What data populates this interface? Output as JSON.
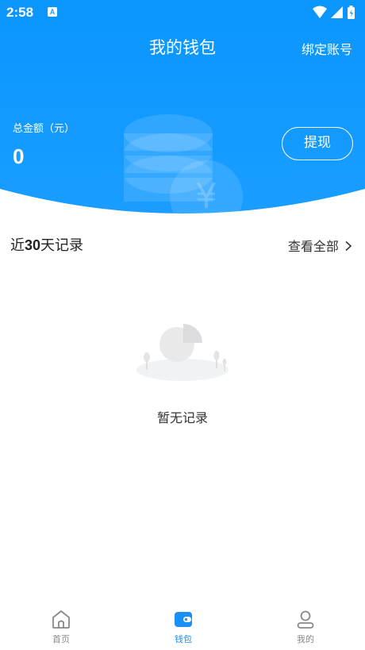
{
  "status_bar": {
    "time": "2:58",
    "notif_letter": "A"
  },
  "header": {
    "title": "我的钱包",
    "bind_account_label": "绑定账号",
    "total_label": "总金额（元）",
    "total_value": "0",
    "withdraw_label": "提现",
    "currency_symbol": "¥",
    "accent_color": "#0a96ff"
  },
  "records": {
    "title_prefix": "近",
    "title_number": "30",
    "title_suffix": "天记录",
    "view_all_label": "查看全部",
    "empty_text": "暂无记录"
  },
  "tabbar": {
    "tabs": [
      {
        "label": "首页",
        "icon": "home-icon",
        "active": false
      },
      {
        "label": "钱包",
        "icon": "wallet-icon",
        "active": true
      },
      {
        "label": "我的",
        "icon": "user-icon",
        "active": false
      }
    ],
    "active_color": "#1a90f5",
    "inactive_color": "#888888"
  }
}
